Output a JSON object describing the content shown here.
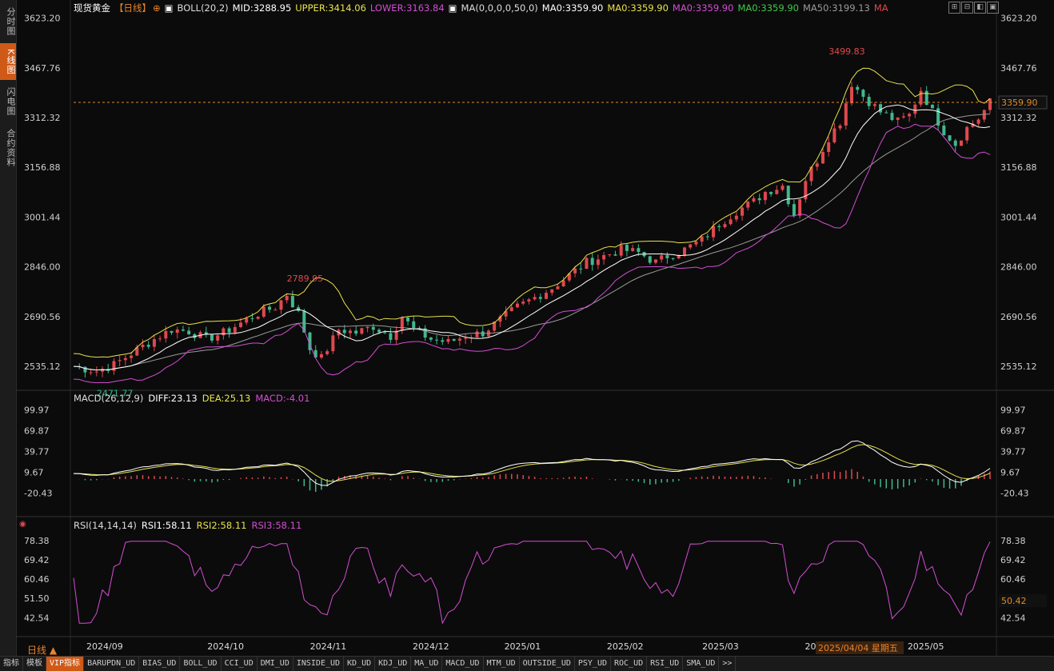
{
  "sidebar": {
    "tabs": [
      {
        "label": "分时图",
        "active": false
      },
      {
        "label": "K线图",
        "active": true
      },
      {
        "label": "闪电图",
        "active": false
      },
      {
        "label": "合约资料",
        "active": false
      }
    ]
  },
  "header": {
    "symbol": "现货黄金",
    "period": "【日线】",
    "period_icon": "target-icon",
    "boll": "BOLL(20,2)",
    "mid": "MID:3288.95",
    "upper": "UPPER:3414.06",
    "lower": "LOWER:3163.84",
    "ma_def": "MA(0,0,0,0,50,0)",
    "ma0_1": "MA0:3359.90",
    "ma0_2": "MA0:3359.90",
    "ma0_3": "MA0:3359.90",
    "ma0_4": "MA0:3359.90",
    "ma50": "MA50:3199.13",
    "ma_label": "MA"
  },
  "window_buttons": [
    "⊞",
    "⊟",
    "◧",
    "▣"
  ],
  "macd_title": {
    "name": "MACD(26,12,9)",
    "diff": "DIFF:23.13",
    "dea": "DEA:25.13",
    "macd": "MACD:-4.01"
  },
  "rsi_title": {
    "name": "RSI(14,14,14)",
    "rsi1": "RSI1:58.11",
    "rsi2": "RSI2:58.11",
    "rsi3": "RSI3:58.11"
  },
  "bottom_left": {
    "period_label": "日线 ▲"
  },
  "bottom_tabs": [
    {
      "label": "指标",
      "active": false
    },
    {
      "label": "模板",
      "active": false
    },
    {
      "label": "VIP指标",
      "active": true
    },
    {
      "label": "BARUPDN_UD",
      "active": false
    },
    {
      "label": "BIAS_UD",
      "active": false
    },
    {
      "label": "BOLL_UD",
      "active": false
    },
    {
      "label": "CCI_UD",
      "active": false
    },
    {
      "label": "DMI_UD",
      "active": false
    },
    {
      "label": "INSIDE_UD",
      "active": false
    },
    {
      "label": "KD_UD",
      "active": false
    },
    {
      "label": "KDJ_UD",
      "active": false
    },
    {
      "label": "MA_UD",
      "active": false
    },
    {
      "label": "MACD_UD",
      "active": false
    },
    {
      "label": "MTM_UD",
      "active": false
    },
    {
      "label": "OUTSIDE_UD",
      "active": false
    },
    {
      "label": "PSY_UD",
      "active": false
    },
    {
      "label": "ROC_UD",
      "active": false
    },
    {
      "label": "RSI_UD",
      "active": false
    },
    {
      "label": "SMA_UD",
      "active": false
    },
    {
      "label": ">>",
      "active": false
    }
  ],
  "colors": {
    "up": "#e0484f",
    "down": "#3fb98d",
    "upper_band": "#e8e24c",
    "lower_band": "#d34ed3",
    "mid_band": "#ffffff",
    "ma50": "#9a9a9a",
    "dea": "#e8e24c",
    "diff": "#ffffff",
    "rsi": "#d34ed3",
    "current_price": "#e08a2a"
  },
  "chart_data": [
    {
      "type": "candlestick",
      "title": "现货黄金【日线】",
      "ylim": [
        2460,
        3630
      ],
      "y_ticks": [
        "3623.20",
        "3467.76",
        "3312.32",
        "3156.88",
        "3001.44",
        "2846.00",
        "2690.56",
        "2535.12"
      ],
      "x_ticks": [
        "2024/09",
        "2024/10",
        "2024/11",
        "2024/12",
        "2025/01",
        "2025/02",
        "2025/03",
        "2025/04",
        "2025/05"
      ],
      "current_price": "3359.90",
      "annotations": {
        "high": "3499.83",
        "mid_high": "2789.95",
        "low": "2471.77",
        "crosshair_date": "2025/04/04 星期五"
      },
      "boll_mid_last": 3288.95,
      "boll_upper_last": 3414.06,
      "boll_lower_last": 3163.84,
      "ma50_last": 3199.13,
      "close_path": [
        [
          0,
          2535
        ],
        [
          8,
          2520
        ],
        [
          14,
          2540
        ],
        [
          20,
          2575
        ],
        [
          28,
          2620
        ],
        [
          34,
          2650
        ],
        [
          40,
          2645
        ],
        [
          46,
          2620
        ],
        [
          52,
          2640
        ],
        [
          58,
          2670
        ],
        [
          64,
          2700
        ],
        [
          70,
          2720
        ],
        [
          74,
          2760
        ],
        [
          78,
          2700
        ],
        [
          82,
          2590
        ],
        [
          86,
          2560
        ],
        [
          92,
          2650
        ],
        [
          98,
          2640
        ],
        [
          104,
          2660
        ],
        [
          110,
          2630
        ],
        [
          114,
          2690
        ],
        [
          118,
          2650
        ],
        [
          124,
          2620
        ],
        [
          130,
          2610
        ],
        [
          136,
          2630
        ],
        [
          142,
          2640
        ],
        [
          148,
          2680
        ],
        [
          154,
          2720
        ],
        [
          160,
          2750
        ],
        [
          166,
          2780
        ],
        [
          172,
          2820
        ],
        [
          178,
          2860
        ],
        [
          184,
          2880
        ],
        [
          190,
          2900
        ],
        [
          196,
          2890
        ],
        [
          202,
          2860
        ],
        [
          206,
          2880
        ],
        [
          212,
          2900
        ],
        [
          218,
          2930
        ],
        [
          224,
          2980
        ],
        [
          230,
          3020
        ],
        [
          236,
          3050
        ],
        [
          240,
          3080
        ],
        [
          246,
          3100
        ],
        [
          250,
          3010
        ],
        [
          254,
          3120
        ],
        [
          258,
          3180
        ],
        [
          262,
          3250
        ],
        [
          266,
          3300
        ],
        [
          270,
          3420
        ],
        [
          274,
          3380
        ],
        [
          280,
          3330
        ],
        [
          286,
          3300
        ],
        [
          290,
          3320
        ],
        [
          294,
          3400
        ],
        [
          298,
          3330
        ],
        [
          302,
          3270
        ],
        [
          306,
          3230
        ],
        [
          310,
          3280
        ],
        [
          314,
          3310
        ],
        [
          318,
          3360
        ]
      ],
      "n_days": 318
    },
    {
      "type": "bar+line",
      "title": "MACD(26,12,9)",
      "ylim": [
        -45,
        105
      ],
      "y_ticks": [
        "99.97",
        "69.87",
        "39.77",
        "9.67",
        "-20.43"
      ],
      "series": [
        {
          "name": "DIFF",
          "last": 23.13
        },
        {
          "name": "DEA",
          "last": 25.13
        },
        {
          "name": "MACD",
          "last": -4.01
        }
      ]
    },
    {
      "type": "line",
      "title": "RSI(14,14,14)",
      "ylim": [
        36,
        82
      ],
      "y_ticks": [
        "78.38",
        "69.42",
        "60.46",
        "51.50",
        "42.54"
      ],
      "current_value": "50.42",
      "series": [
        {
          "name": "RSI1",
          "last": 58.11
        },
        {
          "name": "RSI2",
          "last": 58.11
        },
        {
          "name": "RSI3",
          "last": 58.11
        }
      ]
    }
  ]
}
